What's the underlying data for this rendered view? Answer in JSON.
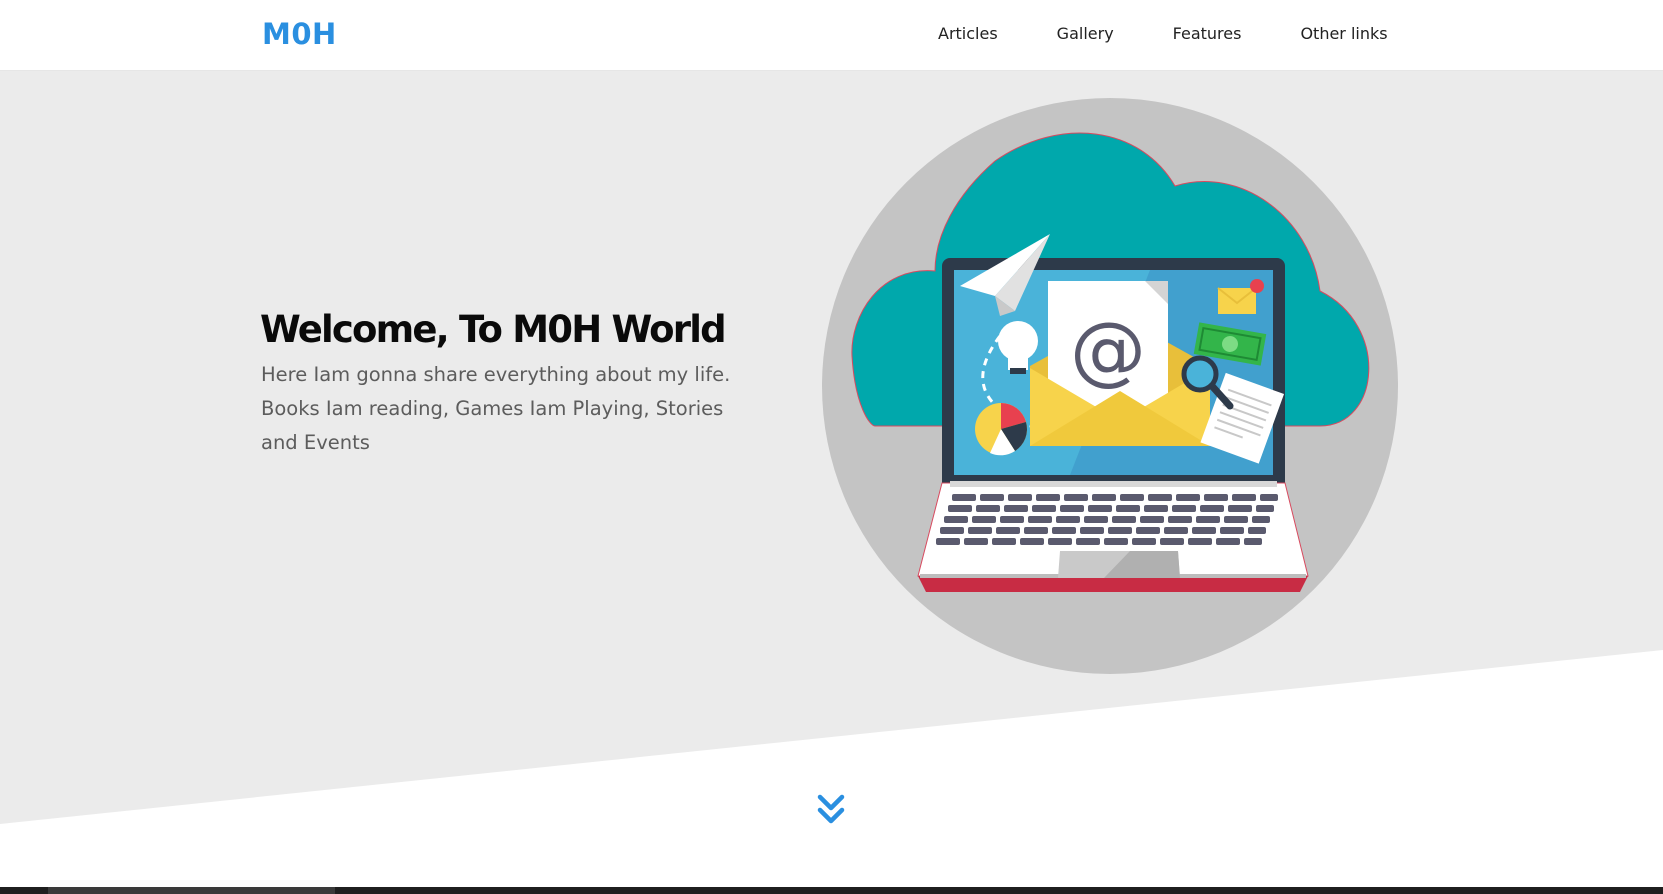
{
  "header": {
    "logo": "M0H",
    "nav": [
      "Articles",
      "Gallery",
      "Features",
      "Other links"
    ]
  },
  "hero": {
    "title": "Welcome, To M0H World",
    "text": "Here Iam gonna share everything about my life. Books Iam reading, Games Iam Playing, Stories and Events"
  },
  "icons": {
    "scroll": "double-chevron-down-icon",
    "illustration": "laptop-email-cloud-illustration"
  },
  "colors": {
    "accent": "#2a8fe0",
    "hero_bg": "#ebebeb",
    "circle": "#c4c4c4",
    "cloud": "#00a8ac",
    "screen": "#4ab3d9",
    "envelope": "#f7d34b",
    "laptop_base_stripe": "#c82c44"
  }
}
